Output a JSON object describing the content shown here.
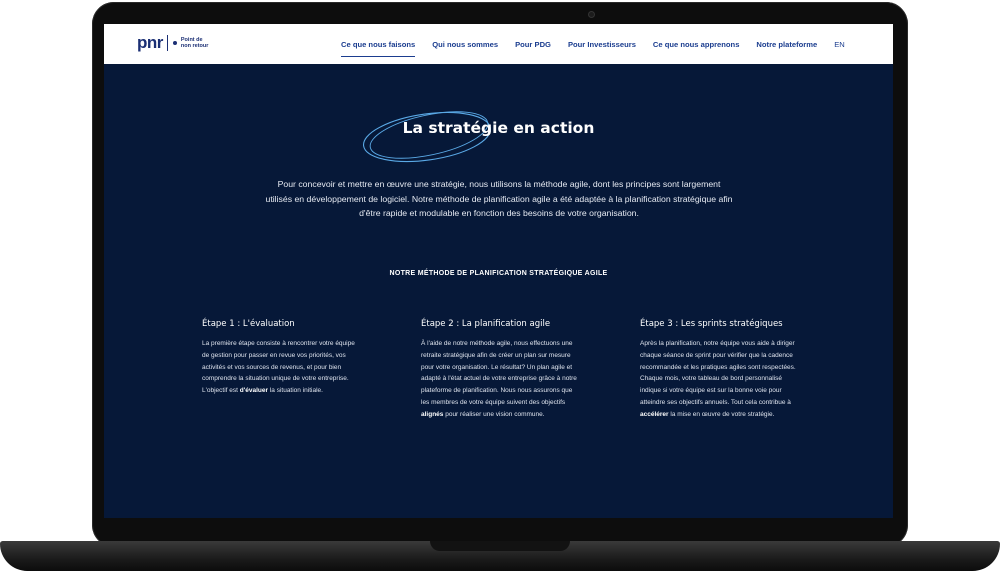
{
  "logo": {
    "mark": "pnr",
    "tagline_line1": "Point de",
    "tagline_line2": "non retour"
  },
  "nav": {
    "items": [
      {
        "label": "Ce que nous faisons",
        "active": true
      },
      {
        "label": "Qui nous sommes",
        "active": false
      },
      {
        "label": "Pour PDG",
        "active": false
      },
      {
        "label": "Pour Investisseurs",
        "active": false
      },
      {
        "label": "Ce que nous apprenons",
        "active": false
      },
      {
        "label": "Notre plateforme",
        "active": false
      }
    ],
    "lang": "EN"
  },
  "hero": {
    "title": "La stratégie en action",
    "intro": "Pour concevoir et mettre en œuvre une stratégie, nous utilisons la méthode agile, dont les principes sont largement utilisés en développement de logiciel. Notre méthode de planification agile a été adaptée à la planification stratégique afin d'être rapide et modulable en fonction des besoins de votre organisation."
  },
  "method": {
    "heading": "NOTRE MÉTHODE DE PLANIFICATION STRATÉGIQUE AGILE"
  },
  "steps": [
    {
      "title": "Étape 1 : L'évaluation",
      "body_before": "La première étape consiste à rencontrer votre équipe de gestion pour passer en revue vos priorités, vos activités et vos sources de revenus, et pour bien comprendre la situation unique de votre entreprise. L'objectif est ",
      "body_bold": "d'évaluer",
      "body_after": " la situation initiale."
    },
    {
      "title": "Étape 2 : La planification agile",
      "body_before": "À l'aide de notre méthode agile, nous effectuons une retraite stratégique afin de créer un plan sur mesure pour votre organisation. Le résultat? Un plan agile et adapté à l'état actuel de votre entreprise grâce à notre plateforme de planification. Nous nous assurons que les membres de votre équipe suivent des objectifs ",
      "body_bold": "alignés",
      "body_after": " pour réaliser une vision commune."
    },
    {
      "title": "Étape 3 : Les sprints stratégiques",
      "body_before": "Après la planification, notre équipe vous aide à diriger chaque séance de sprint pour vérifier que la cadence recommandée et les pratiques agiles sont respectées. Chaque mois, votre tableau de bord personnalisé indique si votre équipe est sur la bonne voie pour atteindre ses objectifs annuels. Tout cela contribue à ",
      "body_bold": "accélérer",
      "body_after": " la mise en œuvre de votre stratégie."
    }
  ],
  "colors": {
    "background": "#061838",
    "brand": "#1b2f74",
    "nav_text": "#1b3d8f",
    "accent_scribble": "#5aa9e6"
  }
}
